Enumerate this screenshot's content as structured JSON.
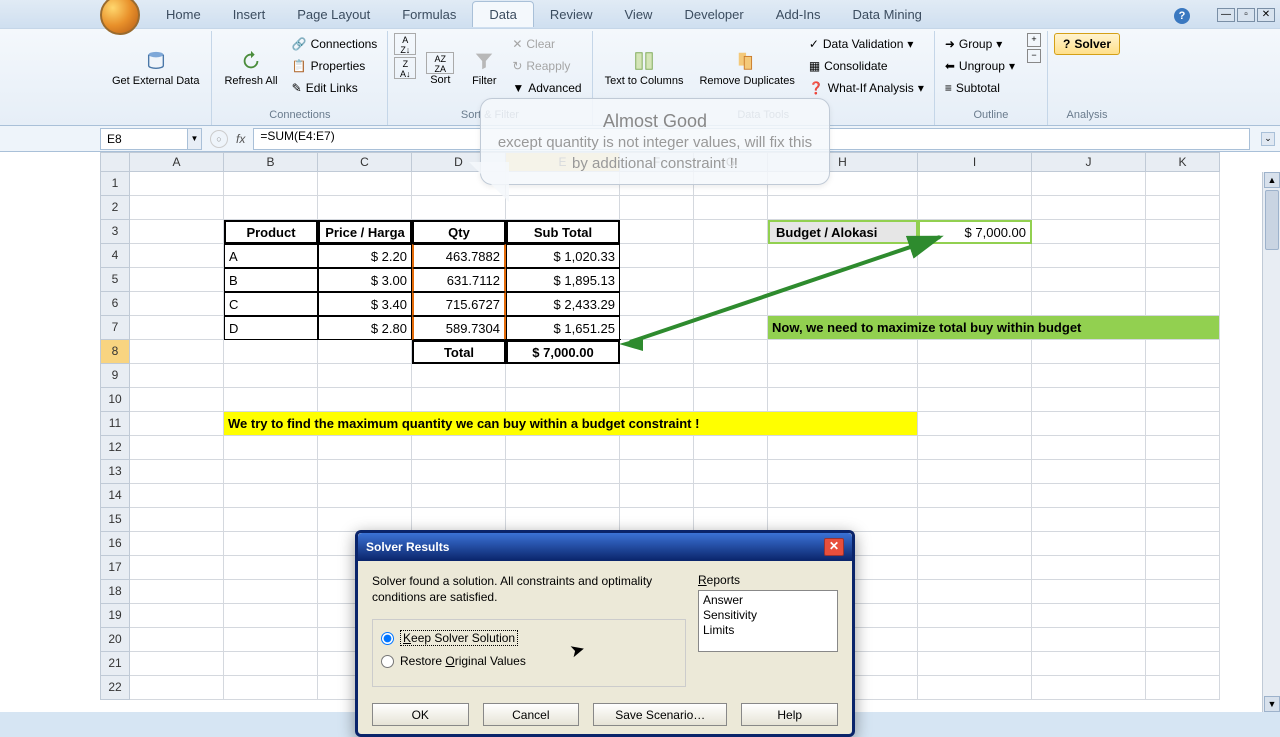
{
  "ribbon": {
    "tabs": [
      "Home",
      "Insert",
      "Page Layout",
      "Formulas",
      "Data",
      "Review",
      "View",
      "Developer",
      "Add-Ins",
      "Data Mining"
    ],
    "active_tab": "Data",
    "groups": {
      "get_external": {
        "title": "",
        "btn": "Get External\nData"
      },
      "refresh": {
        "btn": "Refresh\nAll"
      },
      "connections": {
        "title": "Connections",
        "items": [
          "Connections",
          "Properties",
          "Edit Links"
        ]
      },
      "sortfilter": {
        "title": "Sort & Filter",
        "sort": "Sort",
        "filter": "Filter",
        "clear": "Clear",
        "reapply": "Reapply",
        "advanced": "Advanced"
      },
      "datatools": {
        "title": "Data Tools",
        "textcol": "Text to\nColumns",
        "remdup": "Remove\nDuplicates",
        "dataval": "Data Validation",
        "consol": "Consolidate",
        "whatif": "What-If Analysis"
      },
      "outline": {
        "title": "Outline",
        "group": "Group",
        "ungroup": "Ungroup",
        "subtotal": "Subtotal"
      },
      "analysis": {
        "title": "Analysis",
        "solver": "Solver"
      }
    }
  },
  "formula_bar": {
    "name_box": "E8",
    "formula": "=SUM(E4:E7)",
    "fx": "fx"
  },
  "columns": [
    "A",
    "B",
    "C",
    "D",
    "E",
    "F",
    "G",
    "H",
    "I",
    "J",
    "K"
  ],
  "selected_col_idx": 4,
  "rows_count": 22,
  "selected_row": 8,
  "table": {
    "headers": [
      "Product",
      "Price / Harga",
      "Qty",
      "Sub Total"
    ],
    "rows": [
      {
        "product": "A",
        "price_sym": "$",
        "price": "2.20",
        "qty": "463.7882",
        "sub_sym": "$",
        "sub": "1,020.33"
      },
      {
        "product": "B",
        "price_sym": "$",
        "price": "3.00",
        "qty": "631.7112",
        "sub_sym": "$",
        "sub": "1,895.13"
      },
      {
        "product": "C",
        "price_sym": "$",
        "price": "3.40",
        "qty": "715.6727",
        "sub_sym": "$",
        "sub": "2,433.29"
      },
      {
        "product": "D",
        "price_sym": "$",
        "price": "2.80",
        "qty": "589.7304",
        "sub_sym": "$",
        "sub": "1,651.25"
      }
    ],
    "total_label": "Total",
    "total_sym": "$",
    "total": "7,000.00"
  },
  "budget": {
    "label": "Budget / Alokasi",
    "sym": "$",
    "value": "7,000.00"
  },
  "note_yellow": "We try to find the maximum quantity we can buy within a budget constraint !",
  "note_green": "Now, we need to maximize total buy within budget",
  "callout": {
    "title": "Almost Good",
    "body": "except quantity is not integer values, will fix this by additional constraint !!"
  },
  "dialog": {
    "title": "Solver Results",
    "message": "Solver found a solution.  All constraints and optimality conditions are satisfied.",
    "option_keep": "Keep Solver Solution",
    "option_restore": "Restore Original Values",
    "reports_label": "Reports",
    "reports": [
      "Answer",
      "Sensitivity",
      "Limits"
    ],
    "btn_ok": "OK",
    "btn_cancel": "Cancel",
    "btn_save": "Save Scenario…",
    "btn_help": "Help"
  }
}
